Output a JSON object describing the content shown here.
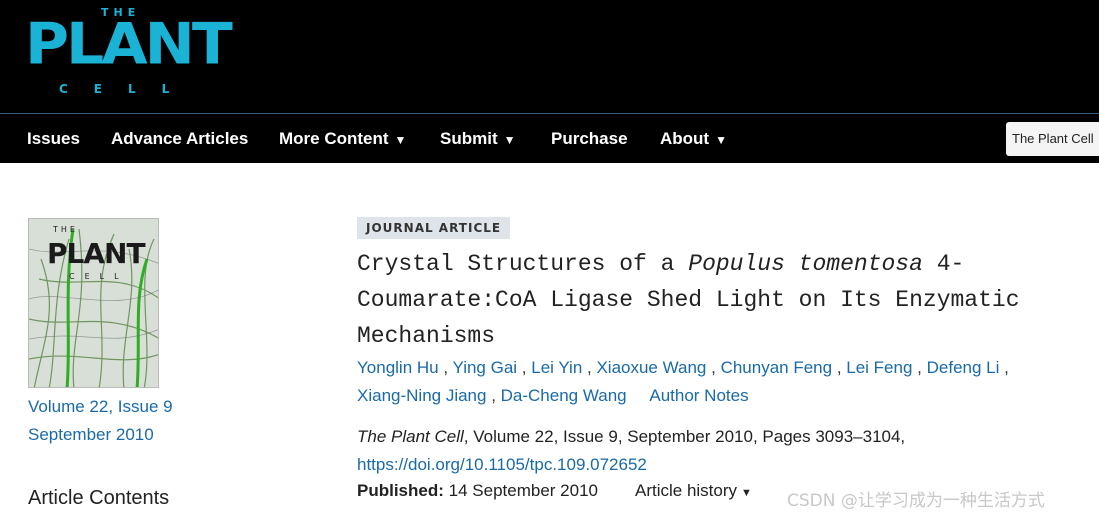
{
  "logo": {
    "the": "THE",
    "plant": "PLANT",
    "cell": "CELL"
  },
  "nav": {
    "items": [
      {
        "label": "Issues",
        "dropdown": false
      },
      {
        "label": "Advance Articles",
        "dropdown": false
      },
      {
        "label": "More Content",
        "dropdown": true
      },
      {
        "label": "Submit",
        "dropdown": true
      },
      {
        "label": "Purchase",
        "dropdown": false
      },
      {
        "label": "About",
        "dropdown": true
      }
    ],
    "caret": "▼",
    "search_scope": "The Plant Cell"
  },
  "sidebar": {
    "cover": {
      "the": "THE",
      "plant": "PLANT",
      "cell": "CELL"
    },
    "volume_issue": "Volume 22, Issue 9",
    "issue_date": "September 2010",
    "contents_heading": "Article Contents"
  },
  "article": {
    "type_badge": "JOURNAL ARTICLE",
    "title_pre": "Crystal Structures of a ",
    "title_italic": "Populus tomentosa",
    "title_post": " 4-Coumarate:CoA Ligase Shed Light on Its Enzymatic Mechanisms",
    "authors": [
      "Yonglin Hu",
      "Ying Gai",
      "Lei Yin",
      "Xiaoxue Wang",
      "Chunyan Feng",
      "Lei Feng",
      "Defeng Li",
      "Xiang-Ning Jiang",
      "Da-Cheng Wang"
    ],
    "author_notes": "Author Notes",
    "journal": "The Plant Cell",
    "citation_rest": ", Volume 22, Issue 9, September 2010, Pages 3093–3104,",
    "doi": "https://doi.org/10.1105/tpc.109.072652",
    "published_label": "Published:",
    "published_date": "14 September 2010",
    "history_label": "Article history",
    "history_caret": "▼"
  },
  "watermark": "CSDN @让学习成为一种生活方式",
  "colors": {
    "brand_cyan": "#1ab3d6",
    "link_blue": "#1a6aa8",
    "header_bg": "#000000",
    "badge_bg": "#dfe3ea"
  }
}
